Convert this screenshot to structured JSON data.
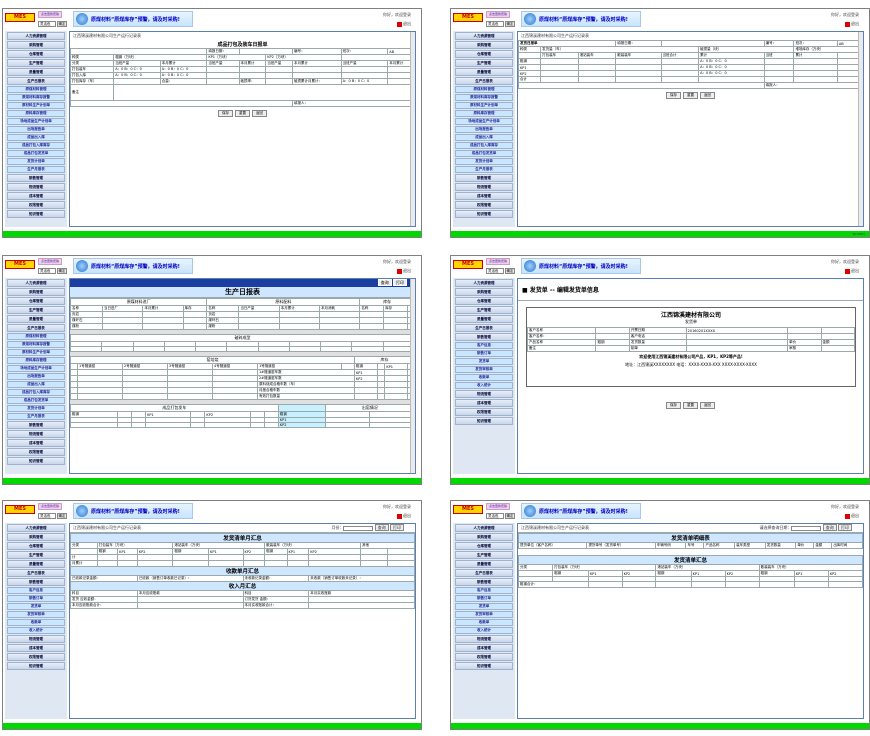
{
  "common": {
    "logo": "MES",
    "tag": "点击更换皮肤",
    "selector": "灵活色",
    "ok": "确定",
    "banner": "原煤材料“原煤库存”预警，请及时采购!",
    "welcome": "你好，欢迎登录",
    "exit": "退出",
    "sidebar": [
      "人力资源管理",
      "采购管理",
      "仓库管理",
      "生产管理",
      "质量管理",
      "生产日报表"
    ],
    "sidebar_bottom": [
      "销售管理",
      "物流管理",
      "成本管理",
      "权限管理",
      "知识管理"
    ],
    "footer": "Tel:0891"
  },
  "s1": {
    "sub": [
      "原煤材料管理",
      "原煤材料库存报警",
      "原材料生产计划单",
      "原料库存管理",
      "场地成品生产计划单",
      "出场报告单",
      "成品出入库",
      "成品打包入库库存",
      "成品打包发货单",
      "发货计划单",
      "生产月报表"
    ],
    "company": "江西锦溪建材有限公司生产运行记录表",
    "title": "成品打包及装车日报单",
    "date_label": "填报日期：",
    "number": "编号：",
    "shift_label": "班次：",
    "shift": "AB",
    "h1": [
      "种类",
      "粗钢（万块）",
      "KP1（万块）",
      "KP2（万块）"
    ],
    "h2": [
      "分类",
      "当班产量",
      "本月累计",
      "当班产量",
      "本月累计",
      "当班产量",
      "本月累计",
      "当班产量",
      "本月累计"
    ],
    "rows": [
      "打包装车",
      "打包入库",
      "打包库存（车）"
    ],
    "row_val": "A：0 B：0 C：0",
    "stock_label": "合量：",
    "plan_label": "破损率：",
    "month_label": "破损累计月累计：",
    "note": "备注",
    "filler": "填报人：",
    "buttons": [
      "保存",
      "重置",
      "返回"
    ]
  },
  "s2": {
    "title": "发货日报单",
    "date_label": "填报日期：",
    "number": "编号：",
    "shift_label": "班次：",
    "shift": "AB",
    "h1": [
      "种类",
      "发货量（车）",
      "破损量（块）"
    ],
    "h2": [
      "打包装车",
      "港站装车",
      "散装装车",
      "当班合计",
      "累计",
      "当班",
      "累计"
    ],
    "rows": [
      "粗钢",
      "KP1",
      "KP2",
      "合计"
    ],
    "row_val": "A：0 B：0 C：0",
    "ratio": "堆场库存（万块）",
    "filler": "填报人：",
    "buttons": [
      "保存",
      "重置",
      "返回"
    ]
  },
  "s3": {
    "sub": [
      "客户信息",
      "销售订单",
      "发货单",
      "发货审核单",
      "收款单",
      "收入统计"
    ],
    "query": [
      "查询",
      "打印"
    ],
    "title": "生产日报表",
    "sec1": "原煤材料进厂",
    "sec2": "原料配料",
    "sec3": "库存",
    "sec4": "破碎成型",
    "sec5": "窑焙烧",
    "sec6": "成品打包发车",
    "sec7": "出窑情况",
    "cols": [
      "名称",
      "当日进厂",
      "本月累计",
      "库存",
      "本月消耗",
      "当日产量",
      "本月累计"
    ],
    "items": [
      "页岩",
      "煤矸石",
      "煤粉"
    ],
    "kiln": [
      "1号隧道窑",
      "2号隧道窑",
      "3号隧道窑",
      "4号隧道窑",
      "1号隧道窑"
    ],
    "lines": [
      "1#隧道窑车数",
      "2#隧道窑车数",
      "原料烧成合格车数（车）",
      "月度合格车数",
      "有效打包数量"
    ],
    "types": [
      "粗钢",
      "KP1",
      "KP2"
    ]
  },
  "s4": {
    "sub": [
      "客户信息",
      "销售订单",
      "发货单",
      "发货审核单",
      "收款单",
      "收入统计"
    ],
    "header": "发货单 -- 编辑发货单信息",
    "company": "江西锦溪建材有限公司",
    "doc": "发货单",
    "fields": [
      "客户名称",
      "客户名称：",
      "客户电话",
      "开票日期",
      "产品名称",
      "发货数量",
      "单价",
      "金额",
      "备注",
      "制单",
      "审核"
    ],
    "num": "20160201XXXX",
    "product": "粗钢",
    "notice": "欢迎使用江西锦溪建材有限公司产品，KP1，KP2等产品!",
    "address": "地址：江西锦溪XXXXXXXX  电话：XXXX-XXXX-XXX  XXXX-XXXX-XXXX",
    "buttons": [
      "保存",
      "重置",
      "返回"
    ]
  },
  "s5": {
    "sub": [
      "客户信息",
      "销售订单",
      "发货单",
      "发货审核单",
      "收款单",
      "收入统计"
    ],
    "company": "江西锦溪建材有限公司生产运行记录表",
    "month_label": "月份：",
    "query": [
      "查询",
      "打印"
    ],
    "t1": "发货清单月汇总",
    "t1c": [
      "分类",
      "打包装车（万块）",
      "港站装车（万块）",
      "散装装车（万块）",
      "其他"
    ],
    "t1s": [
      "粗钢",
      "KP1",
      "KP2"
    ],
    "t1r": [
      "计",
      "月累计",
      "粗钢合计："
    ],
    "t2": "收款单月汇总",
    "t2r": [
      "已收款记录金额：",
      "已收款（销售订单收款已记录）：",
      "未收款记录金额：",
      "未收款（销售订单收款未记录）："
    ],
    "t3": "收入月汇总",
    "t3c": [
      "科目",
      "本月应收账款",
      "科目",
      "本月实收账款"
    ],
    "t3r": [
      "发货 应收金额：",
      "订货发货 金额：",
      "本月应收账款合计：",
      "本月实收账款合计："
    ]
  },
  "s6": {
    "sub": [
      "客户信息",
      "销售订单",
      "发货单",
      "发货审核单",
      "收款单",
      "收入统计"
    ],
    "company": "江西锦溪建材有限公司生产运行记录表",
    "query_label": "请选择查询日期：",
    "query": [
      "查询",
      "打印"
    ],
    "t1": "发货清单明细表",
    "t1c": [
      "提货单位（客户名称）",
      "提货单号（发货单号）",
      "车辆号码",
      "车号",
      "产品名称",
      "装车类型",
      "发货数量",
      "单价",
      "金额",
      "出库时间"
    ],
    "t2": "发货清单汇总",
    "t2c": [
      "分类",
      "打包装车（万块）",
      "港站装车（万块）",
      "散装装车（万块）"
    ],
    "t2s": [
      "粗钢",
      "KP1",
      "KP2"
    ],
    "t2r": "粗钢合计："
  }
}
